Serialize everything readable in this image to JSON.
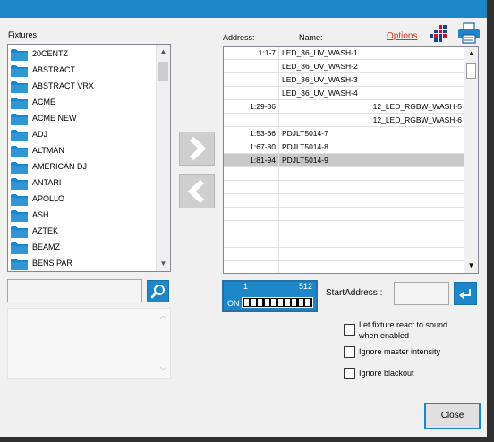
{
  "headers": {
    "fixtures": "Fixtures",
    "address": "Address:",
    "name": "Name:",
    "options": "Options"
  },
  "fixtures": [
    {
      "label": "20CENTZ"
    },
    {
      "label": "ABSTRACT"
    },
    {
      "label": "ABSTRACT VRX"
    },
    {
      "label": "ACME"
    },
    {
      "label": "ACME NEW"
    },
    {
      "label": "ADJ"
    },
    {
      "label": "ALTMAN"
    },
    {
      "label": "AMERICAN DJ"
    },
    {
      "label": "ANTARI"
    },
    {
      "label": "APOLLO"
    },
    {
      "label": "ASH"
    },
    {
      "label": "AZTEK"
    },
    {
      "label": "BEAMZ"
    },
    {
      "label": "BENS PAR"
    }
  ],
  "patch_rows": [
    {
      "address": "1:1-7",
      "name": "LED_36_UV_WASH-1",
      "align": "left"
    },
    {
      "address": "",
      "name": "LED_36_UV_WASH-2",
      "align": "left"
    },
    {
      "address": "",
      "name": "LED_36_UV_WASH-3",
      "align": "left"
    },
    {
      "address": "",
      "name": "LED_36_UV_WASH-4",
      "align": "left"
    },
    {
      "address": "1:29-36",
      "name": "12_LED_RGBW_WASH-5",
      "align": "right"
    },
    {
      "address": "",
      "name": "12_LED_RGBW_WASH-6",
      "align": "right"
    },
    {
      "address": "1:53-66",
      "name": "PDJLT5014-7",
      "align": "left"
    },
    {
      "address": "1:67-80",
      "name": "PDJLT5014-8",
      "align": "left"
    },
    {
      "address": "1:81-94",
      "name": "PDJLT5014-9",
      "align": "left",
      "selected": true
    }
  ],
  "dip": {
    "min": "1",
    "max": "512",
    "on_label": "ON"
  },
  "start_address": {
    "label": "StartAddress :",
    "value": ""
  },
  "options": {
    "react_to_sound_line1": "Let fixture react to sound",
    "react_to_sound_line2": "when enabled",
    "react_to_sound_checked": false,
    "ignore_master": "Ignore master intensity",
    "ignore_master_checked": false,
    "ignore_blackout": "Ignore blackout",
    "ignore_blackout_checked": false
  },
  "buttons": {
    "close": "Close"
  },
  "colors": {
    "accent": "#1c86c8",
    "link": "#d4351f",
    "selected_row": "#c8c8c8"
  },
  "icons": {
    "add_arrow": "chevron-right-icon",
    "remove_arrow": "chevron-left-icon",
    "search": "search-icon",
    "enter": "enter-icon",
    "grid": "grid-icon",
    "print": "printer-icon"
  }
}
